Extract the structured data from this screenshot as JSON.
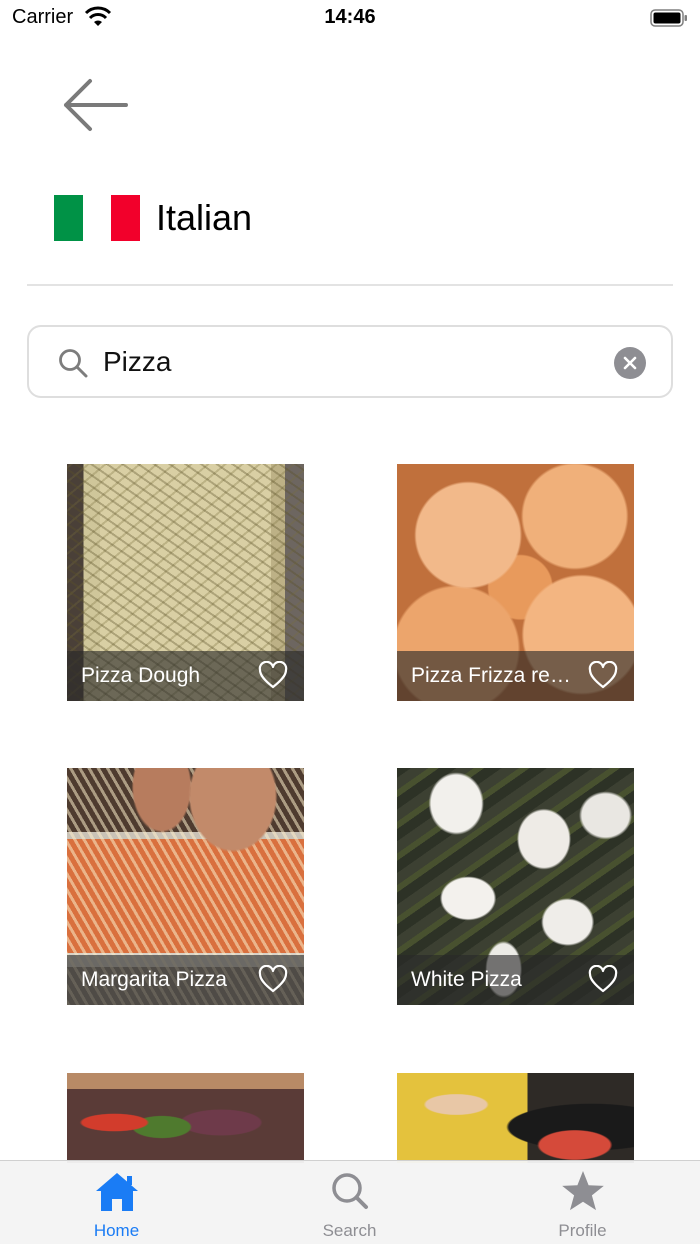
{
  "status_bar": {
    "carrier": "Carrier",
    "time": "14:46"
  },
  "header": {
    "cuisine": "Italian",
    "flag_colors": [
      "#009246",
      "#ffffff",
      "#f2002b"
    ]
  },
  "search": {
    "value": "Pizza",
    "placeholder": ""
  },
  "recipes": [
    {
      "name": "Pizza Dough",
      "favorite": false
    },
    {
      "name": "Pizza Frizza recipe",
      "favorite": false
    },
    {
      "name": "Margarita Pizza",
      "favorite": false
    },
    {
      "name": "White Pizza",
      "favorite": false
    },
    {
      "name": "",
      "favorite": false
    },
    {
      "name": "",
      "favorite": false
    }
  ],
  "tab_bar": {
    "active_color": "#1a7cf5",
    "inactive_color": "#8e8e93",
    "tabs": [
      {
        "label": "Home",
        "icon": "house-icon",
        "active": true
      },
      {
        "label": "Search",
        "icon": "magnifier-icon",
        "active": false
      },
      {
        "label": "Profile",
        "icon": "star-icon",
        "active": false
      }
    ]
  }
}
